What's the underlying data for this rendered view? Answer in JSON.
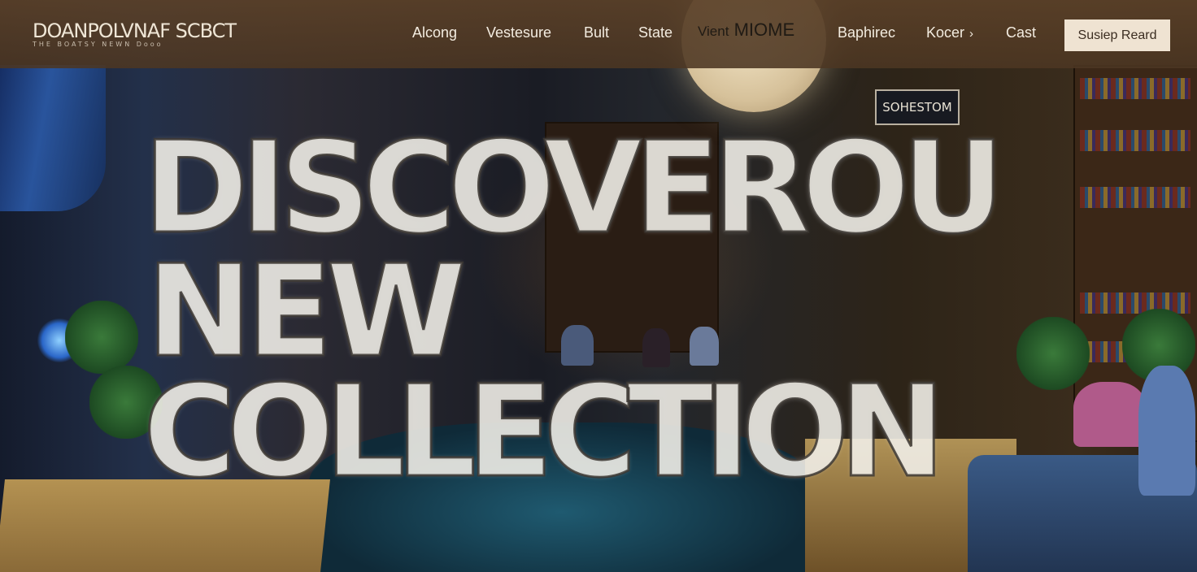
{
  "brand": {
    "name": "DOANPOLVNAF SCBCT",
    "tagline": "THE BOATSY NEWN Dooo"
  },
  "nav": {
    "items": [
      {
        "label": "Alcong"
      },
      {
        "label": "Vestesure"
      },
      {
        "label": "Bult"
      },
      {
        "label": "State"
      }
    ],
    "feature": {
      "prefix": "Vient",
      "main": "MIOME"
    },
    "items_right": [
      {
        "label": "Baphirec"
      },
      {
        "label": "Kocer",
        "icon": "chevron-right-icon"
      },
      {
        "label": "Cast"
      }
    ],
    "cta_label": "Susiep Reard"
  },
  "hero": {
    "line1": "DISCOVEROU",
    "line2": "NEW",
    "line3": "COLLECTION"
  },
  "scene": {
    "sign_text": "SOHESTOM"
  }
}
